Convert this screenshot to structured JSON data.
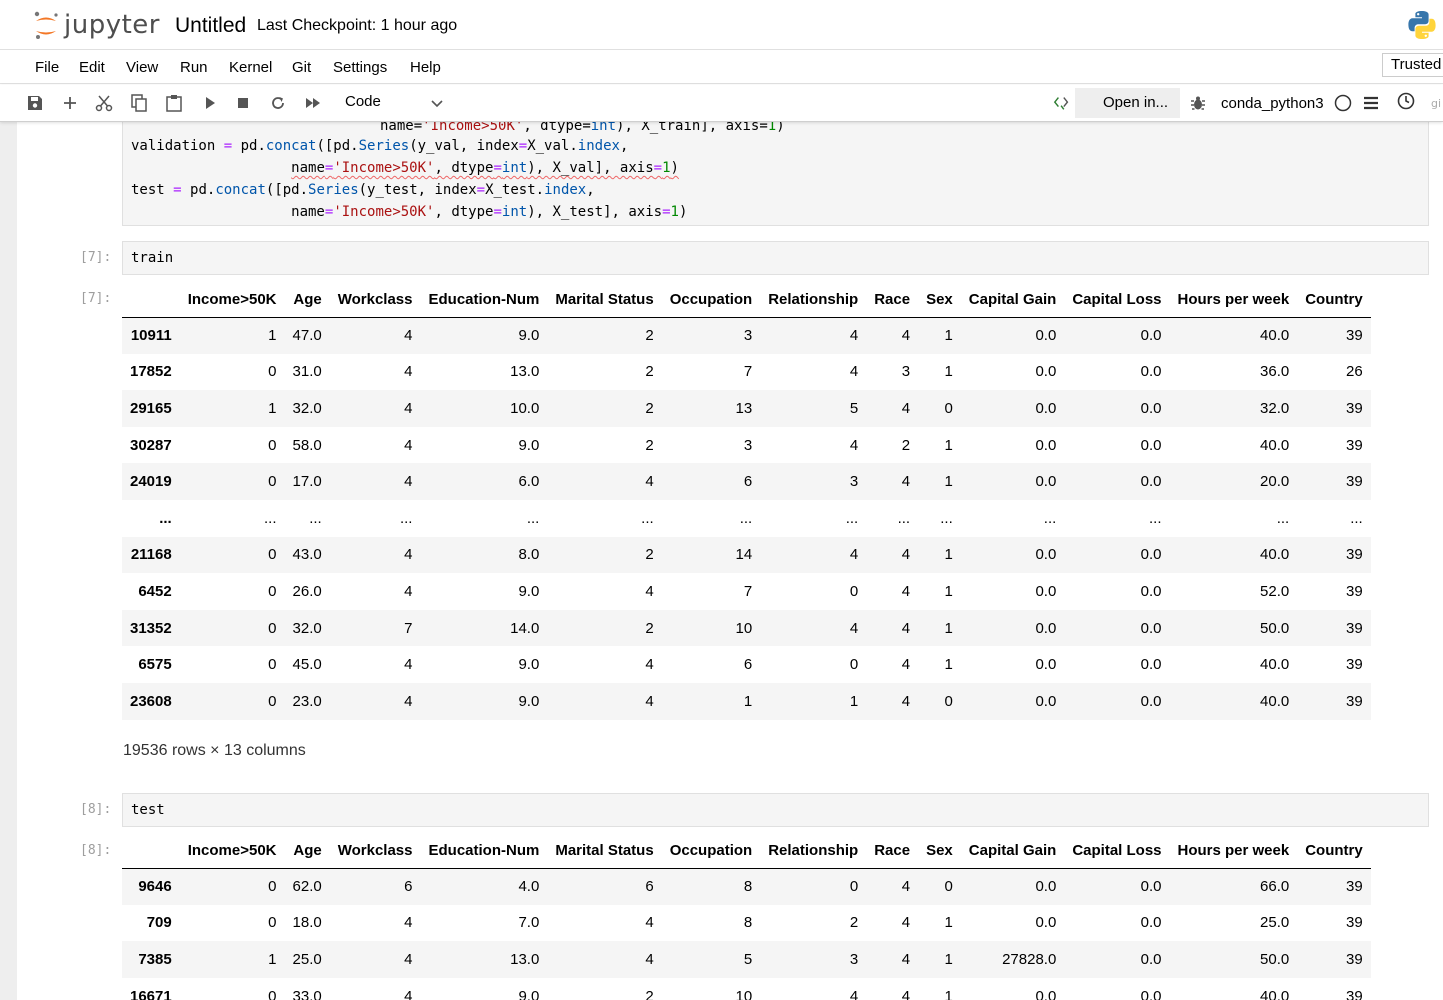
{
  "header": {
    "logo_text": "jupyter",
    "notebook_title": "Untitled",
    "checkpoint": "Last Checkpoint: 1 hour ago"
  },
  "menu": {
    "items": [
      "File",
      "Edit",
      "View",
      "Run",
      "Kernel",
      "Git",
      "Settings",
      "Help"
    ],
    "trusted": "Trusted"
  },
  "toolbar": {
    "cell_type": "Code",
    "open_in": "Open in...",
    "kernel": "conda_python3"
  },
  "cells": {
    "code6_partial": "name='Income>50K', dtype=int), X_train], axis=1)",
    "code7_prompt": "[7]:",
    "code7_source": "train",
    "out7_prompt": "[7]:",
    "code8_prompt": "[8]:",
    "code8_source": "test",
    "out8_prompt": "[8]:"
  },
  "columns": [
    "",
    "Income>50K",
    "Age",
    "Workclass",
    "Education-Num",
    "Marital Status",
    "Occupation",
    "Relationship",
    "Race",
    "Sex",
    "Capital Gain",
    "Capital Loss",
    "Hours per week",
    "Country"
  ],
  "train_rows": [
    [
      "10911",
      "1",
      "47.0",
      "4",
      "9.0",
      "2",
      "3",
      "4",
      "4",
      "1",
      "0.0",
      "0.0",
      "40.0",
      "39"
    ],
    [
      "17852",
      "0",
      "31.0",
      "4",
      "13.0",
      "2",
      "7",
      "4",
      "3",
      "1",
      "0.0",
      "0.0",
      "36.0",
      "26"
    ],
    [
      "29165",
      "1",
      "32.0",
      "4",
      "10.0",
      "2",
      "13",
      "5",
      "4",
      "0",
      "0.0",
      "0.0",
      "32.0",
      "39"
    ],
    [
      "30287",
      "0",
      "58.0",
      "4",
      "9.0",
      "2",
      "3",
      "4",
      "2",
      "1",
      "0.0",
      "0.0",
      "40.0",
      "39"
    ],
    [
      "24019",
      "0",
      "17.0",
      "4",
      "6.0",
      "4",
      "6",
      "3",
      "4",
      "1",
      "0.0",
      "0.0",
      "20.0",
      "39"
    ],
    [
      "...",
      "...",
      "...",
      "...",
      "...",
      "...",
      "...",
      "...",
      "...",
      "...",
      "...",
      "...",
      "...",
      "..."
    ],
    [
      "21168",
      "0",
      "43.0",
      "4",
      "8.0",
      "2",
      "14",
      "4",
      "4",
      "1",
      "0.0",
      "0.0",
      "40.0",
      "39"
    ],
    [
      "6452",
      "0",
      "26.0",
      "4",
      "9.0",
      "4",
      "7",
      "0",
      "4",
      "1",
      "0.0",
      "0.0",
      "52.0",
      "39"
    ],
    [
      "31352",
      "0",
      "32.0",
      "7",
      "14.0",
      "2",
      "10",
      "4",
      "4",
      "1",
      "0.0",
      "0.0",
      "50.0",
      "39"
    ],
    [
      "6575",
      "0",
      "45.0",
      "4",
      "9.0",
      "4",
      "6",
      "0",
      "4",
      "1",
      "0.0",
      "0.0",
      "40.0",
      "39"
    ],
    [
      "23608",
      "0",
      "23.0",
      "4",
      "9.0",
      "4",
      "1",
      "1",
      "4",
      "0",
      "0.0",
      "0.0",
      "40.0",
      "39"
    ]
  ],
  "train_shape": "19536 rows × 13 columns",
  "test_rows": [
    [
      "9646",
      "0",
      "62.0",
      "6",
      "4.0",
      "6",
      "8",
      "0",
      "4",
      "0",
      "0.0",
      "0.0",
      "66.0",
      "39"
    ],
    [
      "709",
      "0",
      "18.0",
      "4",
      "7.0",
      "4",
      "8",
      "2",
      "4",
      "1",
      "0.0",
      "0.0",
      "25.0",
      "39"
    ],
    [
      "7385",
      "1",
      "25.0",
      "4",
      "13.0",
      "4",
      "5",
      "3",
      "4",
      "1",
      "27828.0",
      "0.0",
      "50.0",
      "39"
    ],
    [
      "16671",
      "0",
      "33.0",
      "4",
      "9.0",
      "2",
      "10",
      "4",
      "4",
      "1",
      "0.0",
      "0.0",
      "40.0",
      "39"
    ]
  ]
}
